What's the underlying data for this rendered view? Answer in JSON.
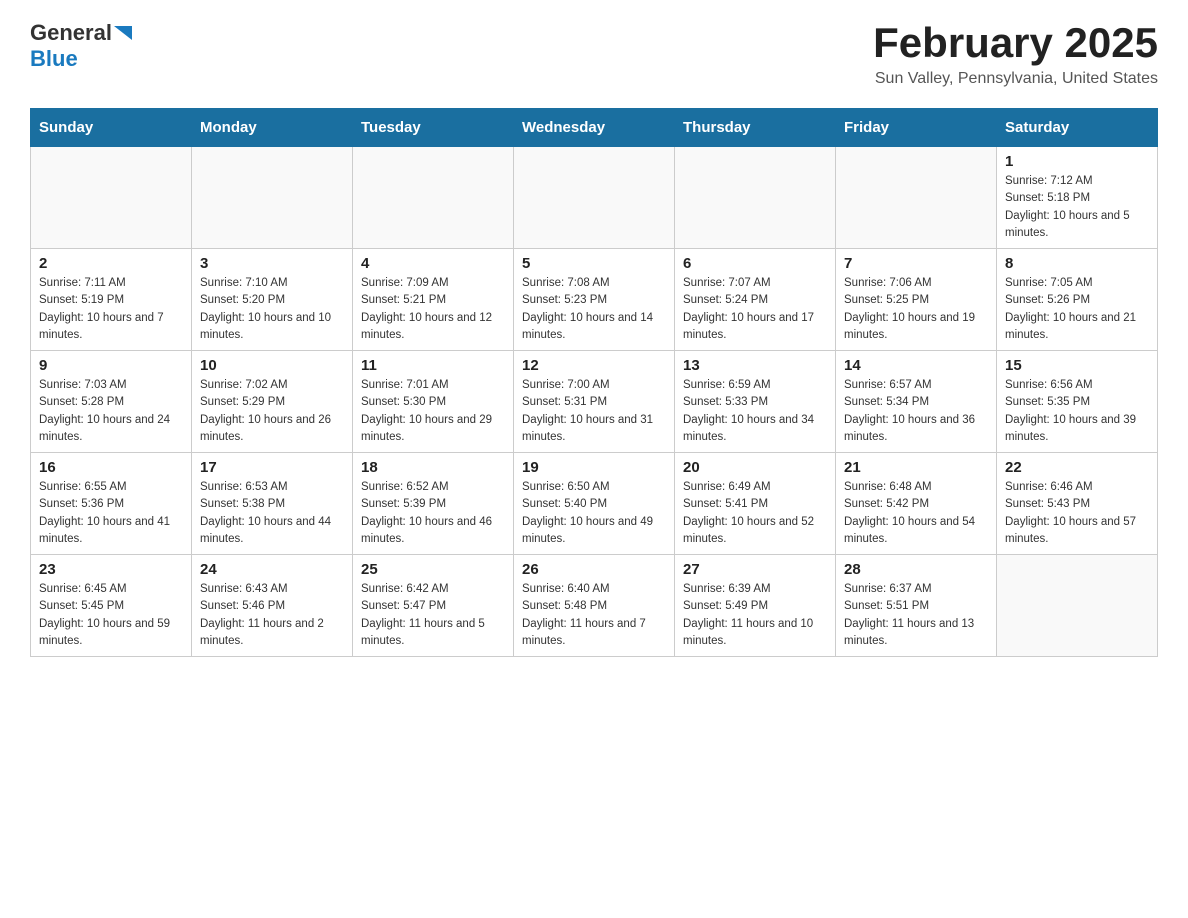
{
  "header": {
    "logo_general": "General",
    "logo_blue": "Blue",
    "title": "February 2025",
    "subtitle": "Sun Valley, Pennsylvania, United States"
  },
  "days_of_week": [
    "Sunday",
    "Monday",
    "Tuesday",
    "Wednesday",
    "Thursday",
    "Friday",
    "Saturday"
  ],
  "weeks": [
    {
      "days": [
        {
          "number": "",
          "info": "",
          "empty": true
        },
        {
          "number": "",
          "info": "",
          "empty": true
        },
        {
          "number": "",
          "info": "",
          "empty": true
        },
        {
          "number": "",
          "info": "",
          "empty": true
        },
        {
          "number": "",
          "info": "",
          "empty": true
        },
        {
          "number": "",
          "info": "",
          "empty": true
        },
        {
          "number": "1",
          "info": "Sunrise: 7:12 AM\nSunset: 5:18 PM\nDaylight: 10 hours and 5 minutes.",
          "empty": false
        }
      ]
    },
    {
      "days": [
        {
          "number": "2",
          "info": "Sunrise: 7:11 AM\nSunset: 5:19 PM\nDaylight: 10 hours and 7 minutes.",
          "empty": false
        },
        {
          "number": "3",
          "info": "Sunrise: 7:10 AM\nSunset: 5:20 PM\nDaylight: 10 hours and 10 minutes.",
          "empty": false
        },
        {
          "number": "4",
          "info": "Sunrise: 7:09 AM\nSunset: 5:21 PM\nDaylight: 10 hours and 12 minutes.",
          "empty": false
        },
        {
          "number": "5",
          "info": "Sunrise: 7:08 AM\nSunset: 5:23 PM\nDaylight: 10 hours and 14 minutes.",
          "empty": false
        },
        {
          "number": "6",
          "info": "Sunrise: 7:07 AM\nSunset: 5:24 PM\nDaylight: 10 hours and 17 minutes.",
          "empty": false
        },
        {
          "number": "7",
          "info": "Sunrise: 7:06 AM\nSunset: 5:25 PM\nDaylight: 10 hours and 19 minutes.",
          "empty": false
        },
        {
          "number": "8",
          "info": "Sunrise: 7:05 AM\nSunset: 5:26 PM\nDaylight: 10 hours and 21 minutes.",
          "empty": false
        }
      ]
    },
    {
      "days": [
        {
          "number": "9",
          "info": "Sunrise: 7:03 AM\nSunset: 5:28 PM\nDaylight: 10 hours and 24 minutes.",
          "empty": false
        },
        {
          "number": "10",
          "info": "Sunrise: 7:02 AM\nSunset: 5:29 PM\nDaylight: 10 hours and 26 minutes.",
          "empty": false
        },
        {
          "number": "11",
          "info": "Sunrise: 7:01 AM\nSunset: 5:30 PM\nDaylight: 10 hours and 29 minutes.",
          "empty": false
        },
        {
          "number": "12",
          "info": "Sunrise: 7:00 AM\nSunset: 5:31 PM\nDaylight: 10 hours and 31 minutes.",
          "empty": false
        },
        {
          "number": "13",
          "info": "Sunrise: 6:59 AM\nSunset: 5:33 PM\nDaylight: 10 hours and 34 minutes.",
          "empty": false
        },
        {
          "number": "14",
          "info": "Sunrise: 6:57 AM\nSunset: 5:34 PM\nDaylight: 10 hours and 36 minutes.",
          "empty": false
        },
        {
          "number": "15",
          "info": "Sunrise: 6:56 AM\nSunset: 5:35 PM\nDaylight: 10 hours and 39 minutes.",
          "empty": false
        }
      ]
    },
    {
      "days": [
        {
          "number": "16",
          "info": "Sunrise: 6:55 AM\nSunset: 5:36 PM\nDaylight: 10 hours and 41 minutes.",
          "empty": false
        },
        {
          "number": "17",
          "info": "Sunrise: 6:53 AM\nSunset: 5:38 PM\nDaylight: 10 hours and 44 minutes.",
          "empty": false
        },
        {
          "number": "18",
          "info": "Sunrise: 6:52 AM\nSunset: 5:39 PM\nDaylight: 10 hours and 46 minutes.",
          "empty": false
        },
        {
          "number": "19",
          "info": "Sunrise: 6:50 AM\nSunset: 5:40 PM\nDaylight: 10 hours and 49 minutes.",
          "empty": false
        },
        {
          "number": "20",
          "info": "Sunrise: 6:49 AM\nSunset: 5:41 PM\nDaylight: 10 hours and 52 minutes.",
          "empty": false
        },
        {
          "number": "21",
          "info": "Sunrise: 6:48 AM\nSunset: 5:42 PM\nDaylight: 10 hours and 54 minutes.",
          "empty": false
        },
        {
          "number": "22",
          "info": "Sunrise: 6:46 AM\nSunset: 5:43 PM\nDaylight: 10 hours and 57 minutes.",
          "empty": false
        }
      ]
    },
    {
      "days": [
        {
          "number": "23",
          "info": "Sunrise: 6:45 AM\nSunset: 5:45 PM\nDaylight: 10 hours and 59 minutes.",
          "empty": false
        },
        {
          "number": "24",
          "info": "Sunrise: 6:43 AM\nSunset: 5:46 PM\nDaylight: 11 hours and 2 minutes.",
          "empty": false
        },
        {
          "number": "25",
          "info": "Sunrise: 6:42 AM\nSunset: 5:47 PM\nDaylight: 11 hours and 5 minutes.",
          "empty": false
        },
        {
          "number": "26",
          "info": "Sunrise: 6:40 AM\nSunset: 5:48 PM\nDaylight: 11 hours and 7 minutes.",
          "empty": false
        },
        {
          "number": "27",
          "info": "Sunrise: 6:39 AM\nSunset: 5:49 PM\nDaylight: 11 hours and 10 minutes.",
          "empty": false
        },
        {
          "number": "28",
          "info": "Sunrise: 6:37 AM\nSunset: 5:51 PM\nDaylight: 11 hours and 13 minutes.",
          "empty": false
        },
        {
          "number": "",
          "info": "",
          "empty": true
        }
      ]
    }
  ]
}
